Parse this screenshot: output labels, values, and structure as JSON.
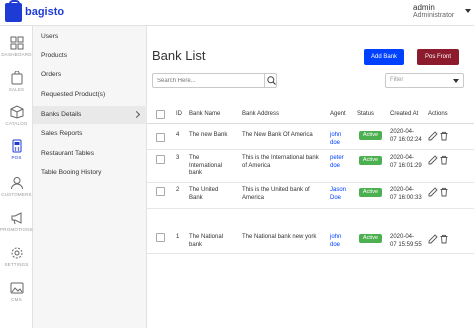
{
  "header": {
    "brand": "bagisto",
    "user_name": "admin",
    "user_role": "Administrator"
  },
  "iconbar": [
    {
      "label": "DASHBOARD",
      "icon": "dashboard-icon"
    },
    {
      "label": "SALES",
      "icon": "sales-icon"
    },
    {
      "label": "CATALOG",
      "icon": "catalog-icon"
    },
    {
      "label": "POS",
      "icon": "pos-icon",
      "active": true
    },
    {
      "label": "CUSTOMERS",
      "icon": "customers-icon"
    },
    {
      "label": "PROMOTIONS",
      "icon": "promotions-icon"
    },
    {
      "label": "SETTINGS",
      "icon": "settings-icon"
    },
    {
      "label": "CMS",
      "icon": "cms-icon"
    }
  ],
  "subnav": [
    {
      "label": "Users"
    },
    {
      "label": "Products"
    },
    {
      "label": "Orders"
    },
    {
      "label": "Requested Product(s)"
    },
    {
      "label": "Banks Details",
      "active": true
    },
    {
      "label": "Sales Reports"
    },
    {
      "label": "Restaurant Tables"
    },
    {
      "label": "Table Booing History"
    }
  ],
  "page": {
    "title": "Bank List",
    "add_button": "Add Bank",
    "pos_button": "Pos Front",
    "search_placeholder": "Search Here...",
    "filter_label": "Filter"
  },
  "table": {
    "columns": [
      "ID",
      "Bank Name",
      "Bank Address",
      "Agent",
      "Status",
      "Created At",
      "Actions"
    ],
    "rows": [
      {
        "id": "4",
        "name": [
          "The new Bank"
        ],
        "address": [
          "The New Bank Of America"
        ],
        "agent": [
          "john",
          "doe"
        ],
        "status": "Active",
        "created": [
          "2020-04-",
          "07 16:02:24"
        ]
      },
      {
        "id": "3",
        "name": [
          "The",
          "International",
          "bank"
        ],
        "address": [
          "This is the International bank",
          "of America"
        ],
        "agent": [
          "peter",
          "doe"
        ],
        "status": "Active",
        "created": [
          "2020-04-",
          "07 16:01:29"
        ]
      },
      {
        "id": "2",
        "name": [
          "The United",
          "Bank"
        ],
        "address": [
          "This is the United bank of",
          "America"
        ],
        "agent": [
          "Jason",
          "Doe"
        ],
        "status": "Active",
        "created": [
          "2020-04-",
          "07 16:00:33"
        ]
      },
      {
        "id": "1",
        "name": [
          "The National",
          "bank"
        ],
        "address": [
          "The National bank new york"
        ],
        "agent": [
          "john",
          "doe"
        ],
        "status": "Active",
        "created": [
          "2020-04-",
          "07 15:59:55"
        ]
      }
    ]
  },
  "colors": {
    "brand": "#1e3bd6",
    "primary_button": "#0041ff",
    "pos_button": "#8b1b2d",
    "active_badge": "#4caf50"
  }
}
